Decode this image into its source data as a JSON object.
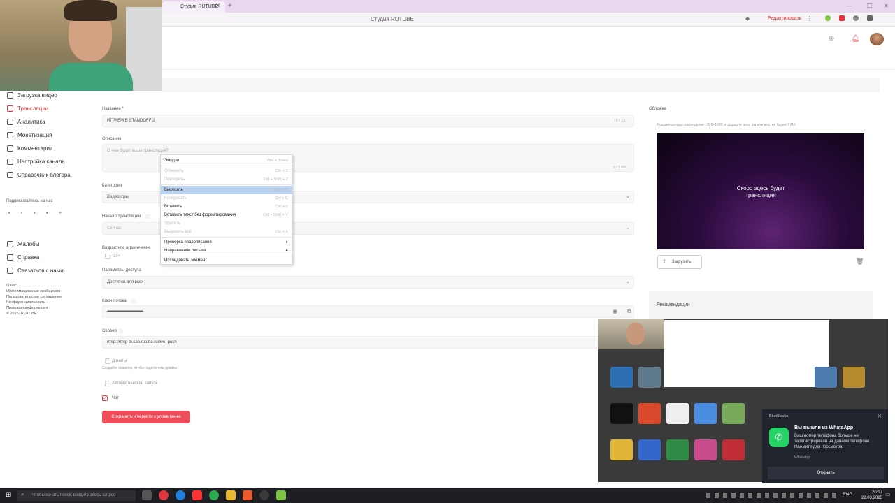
{
  "browser": {
    "tab_title": "Студия RUTUBE",
    "site_title": "Студия RUTUBE",
    "edit_label": "Редактировать"
  },
  "sidebar": {
    "items": [
      {
        "label": "Загрузка видео"
      },
      {
        "label": "Трансляции"
      },
      {
        "label": "Аналитика"
      },
      {
        "label": "Монетизация"
      },
      {
        "label": "Комментарии"
      },
      {
        "label": "Настройка канала"
      },
      {
        "label": "Справочник блогера"
      }
    ],
    "subscribe_label": "Подписывайтесь на нас",
    "support_items": [
      {
        "label": "Жалобы"
      },
      {
        "label": "Справка"
      },
      {
        "label": "Связаться с нами"
      }
    ],
    "footer_links": [
      "О нас",
      "Информационные сообщения",
      "Пользовательское соглашение",
      "Конфиденциальность",
      "Правовая информация",
      "© 2025, RUTUBE"
    ]
  },
  "form": {
    "title_label": "Название *",
    "title_value": "ИГРАЕМ В STANDOFF 2",
    "title_count": "19 / 100",
    "desc_label": "Описание",
    "desc_placeholder": "О чем будет ваша трансляция?",
    "desc_count": "0 / 5 000",
    "category_label": "Категория",
    "category_value": "Видеоигры",
    "start_label": "Начало трансляции",
    "start_value": "Сейчас",
    "age_label": "Возрастное ограничение",
    "age_value": "18+",
    "access_label": "Параметры доступа",
    "access_value": "Доступно для всех",
    "key_label": "Ключ потока",
    "key_value": "••••••••••••••••••••••••••••••••••••••••••••••••••••••••••••••••••••",
    "server_label": "Сервер",
    "server_value": "rtmp://rtmp-lb.sao.rutube.ru/live_push",
    "donations_label": "Донаты",
    "donations_hint": "Создайте кошелек, чтобы подключить донаты",
    "autostart_label": "Автоматический запуск",
    "chat_label": "Чат",
    "save_button": "Сохранить и перейти к управлению"
  },
  "cover": {
    "label": "Обложка",
    "hint": "Рекомендуемое разрешение 1920×1080, в формате jpeg, jpg или png, не более 7 МБ",
    "preview_text_line1": "Скоро здесь будет",
    "preview_text_line2": "трансляция",
    "upload_button": "Загрузить"
  },
  "recommendations_label": "Рекомендации",
  "context_menu": {
    "items": [
      {
        "label": "Эмодзи",
        "shortcut": "Win + Точка"
      },
      {
        "label": "Отменить",
        "shortcut": "Ctrl + Z"
      },
      {
        "label": "Повторить",
        "shortcut": "Ctrl + Shift + Z"
      },
      {
        "label": "Вырезать",
        "shortcut": "Ctrl + X"
      },
      {
        "label": "Копировать",
        "shortcut": "Ctrl + C"
      },
      {
        "label": "Вставить",
        "shortcut": "Ctrl + V"
      },
      {
        "label": "Вставить текст без форматирования",
        "shortcut": "Ctrl + Shift + V"
      },
      {
        "label": "Удалить",
        "shortcut": ""
      },
      {
        "label": "Выделить всё",
        "shortcut": "Ctrl + A"
      },
      {
        "label": "Проверка правописания",
        "shortcut": ""
      },
      {
        "label": "Направление письма",
        "shortcut": ""
      },
      {
        "label": "Исследовать элемент",
        "shortcut": ""
      }
    ]
  },
  "notification": {
    "app": "BlueStacks",
    "title": "Вы вышли из WhatsApp",
    "body": "Ваш номер телефона больше не зарегистрирован на данном телефоне. Нажмите для просмотра.",
    "source": "WhatsApp",
    "action": "Открыть"
  },
  "taskbar": {
    "search_placeholder": "Чтобы начать поиск, введите здесь запрос",
    "lang": "ENG",
    "time": "20:17",
    "date": "22.03.2025"
  }
}
